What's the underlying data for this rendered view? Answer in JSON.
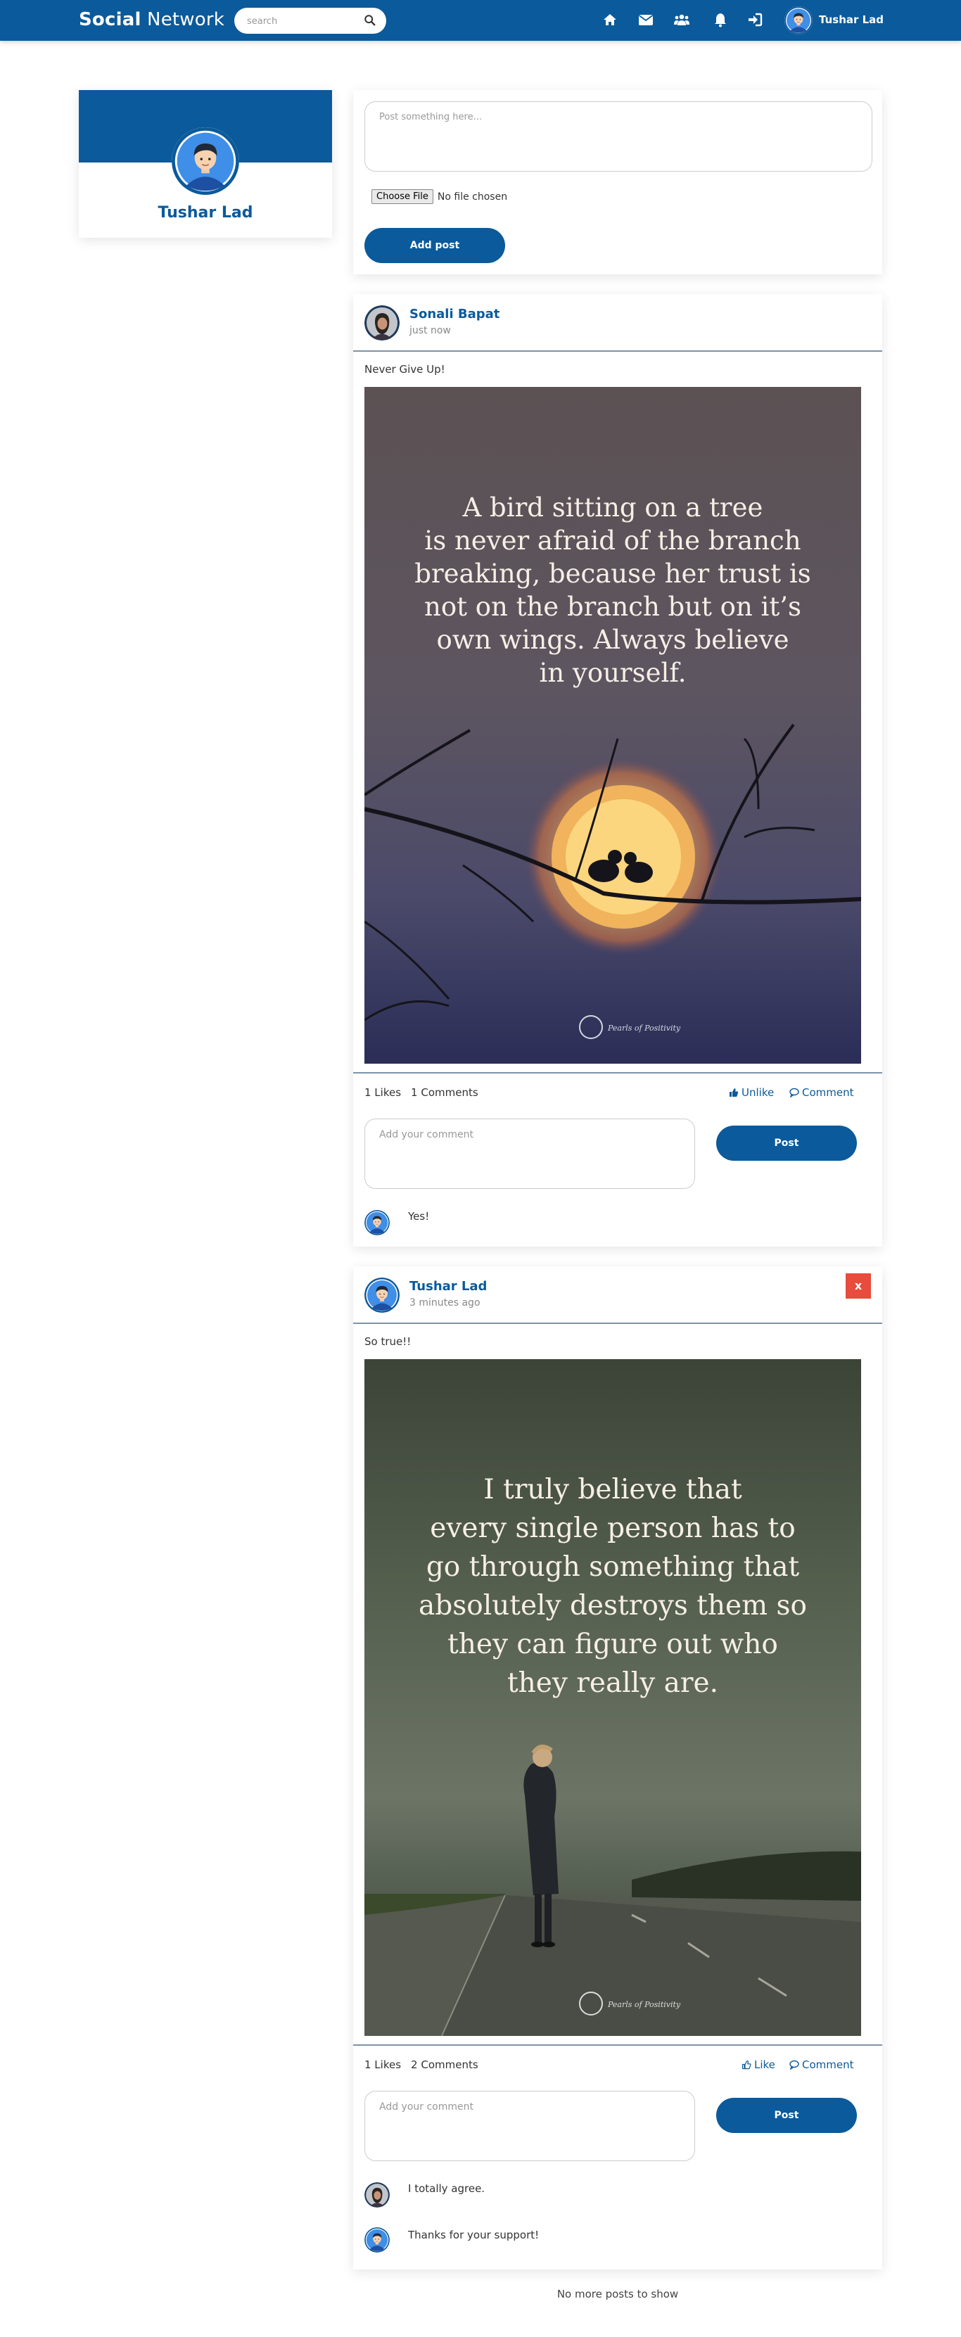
{
  "navbar": {
    "brand_bold": "Social",
    "brand_rest": " Network",
    "search_placeholder": "search",
    "icons": [
      "home-icon",
      "envelope-icon",
      "users-icon",
      "bell-icon",
      "sign-in-icon"
    ],
    "username": "Tushar Lad"
  },
  "profile": {
    "name": "Tushar Lad"
  },
  "create_post": {
    "placeholder": "Post something here...",
    "choose_file": "Choose File",
    "no_file": "No file chosen",
    "add_post": "Add post"
  },
  "posts": [
    {
      "author": "Sonali Bapat",
      "time": "just now",
      "caption": "Never Give Up!",
      "quote": [
        "A bird sitting on a tree",
        "is never afraid of the branch",
        "breaking, because her trust is",
        "not on the branch but on it’s",
        "own wings. Always believe",
        "in yourself."
      ],
      "likes": "1 Likes",
      "comments_count": "1 Comments",
      "like_action": "Unlike",
      "comment_action": "Comment",
      "comment_placeholder": "Add your comment",
      "post_button": "Post",
      "comments": [
        {
          "text": "Yes!"
        }
      ]
    },
    {
      "author": "Tushar Lad",
      "time": "3 minutes ago",
      "delete_label": "x",
      "caption": "So true!!",
      "quote": [
        "I truly believe that",
        "every single person has to",
        "go through something that",
        "absolutely destroys them so",
        "they can figure out who",
        "they really are."
      ],
      "likes": "1 Likes",
      "comments_count": "2 Comments",
      "like_action": "Like",
      "comment_action": "Comment",
      "comment_placeholder": "Add your comment",
      "post_button": "Post",
      "comments": [
        {
          "text": "I totally agree."
        },
        {
          "text": "Thanks for your support!"
        }
      ]
    }
  ],
  "footer_text": "No more posts to show",
  "colors": {
    "primary": "#0b5a9b",
    "danger": "#e74c3c",
    "background": "#ffffff"
  }
}
